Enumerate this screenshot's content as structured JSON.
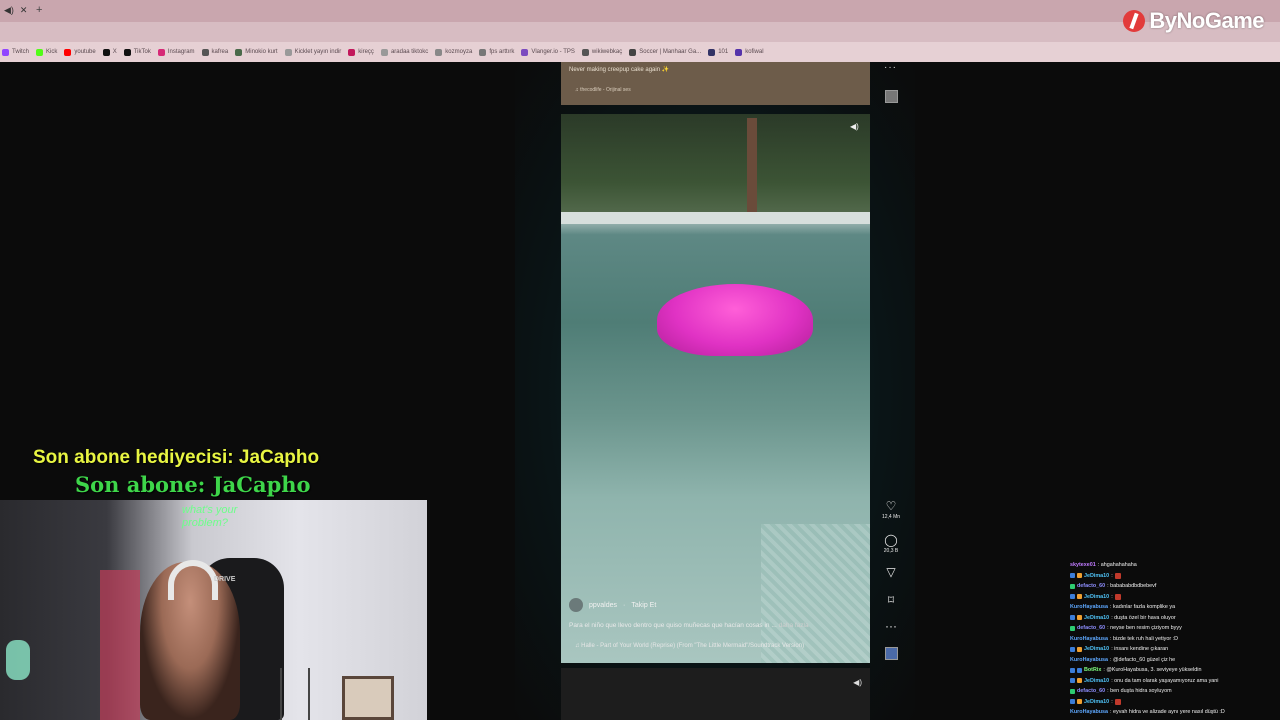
{
  "browser": {
    "bookmarks": [
      {
        "label": "Twitch",
        "color": "#9146ff"
      },
      {
        "label": "Kick",
        "color": "#53fc18"
      },
      {
        "label": "youtube",
        "color": "#ff0000"
      },
      {
        "label": "X",
        "color": "#111111"
      },
      {
        "label": "TikTok",
        "color": "#111111"
      },
      {
        "label": "Instagram",
        "color": "#d62976"
      },
      {
        "label": "kafrea",
        "color": "#555555"
      },
      {
        "label": "Minokio kurt",
        "color": "#4a6a4a"
      },
      {
        "label": "Kicklet yayın indir",
        "color": "#999999"
      },
      {
        "label": "kireçç",
        "color": "#c2185b"
      },
      {
        "label": "aradaa tiktokc",
        "color": "#999999"
      },
      {
        "label": "kozmoyza",
        "color": "#888888"
      },
      {
        "label": "fps arttırk",
        "color": "#777777"
      },
      {
        "label": "Vlanger.io - TPS",
        "color": "#7b4bbf"
      },
      {
        "label": "wikiwebkaç",
        "color": "#555555"
      },
      {
        "label": "Soccer | Manhaar Ga...",
        "color": "#444444"
      },
      {
        "label": "101",
        "color": "#333366"
      },
      {
        "label": "kofiwal",
        "color": "#5533aa"
      }
    ],
    "logo_text": "ByNoGame"
  },
  "feed": {
    "prev_card": {
      "caption": "Never making creepup cake again ✨",
      "sound": "♫  thecodlife - Orijinal ses"
    },
    "video": {
      "author": "ppvaldes",
      "separator": "·",
      "follow_label": "Takip Et",
      "caption": "Para el niño que llevo dentro que quiso muñecas que hacían cosas in ...",
      "more_label": "daha fazla",
      "song": "♫  Halle - Part of Your World (Reprise) (From \"The Little Mermaid\"/Soundtrack Version)"
    },
    "actions": {
      "likes": "12,4 Mn",
      "comments": "20,3 B"
    }
  },
  "overlay": {
    "last_gifter": "Son abone hediyecisi: JaCapho",
    "last_sub": "Son abone: JaCapho"
  },
  "webcam": {
    "neon_sign": "what's your problem?",
    "chair_brand": "DRIVE"
  },
  "chat": [
    {
      "user": "skytexe01",
      "color": "#c07bff",
      "text": ": ahgahahahaha",
      "badges": [],
      "emote": false
    },
    {
      "user": "JeDima10",
      "color": "#4fc3f7",
      "text": ":",
      "badges": [
        "#3b7dd8",
        "#f0a030"
      ],
      "emote": true
    },
    {
      "user": "defacto_60",
      "color": "#8f8fff",
      "text": ": babababdbdbebevf",
      "badges": [
        "#2ecc71"
      ],
      "emote": false
    },
    {
      "user": "JeDima10",
      "color": "#4fc3f7",
      "text": ":",
      "badges": [
        "#3b7dd8",
        "#f0a030"
      ],
      "emote": true
    },
    {
      "user": "KuroHayabusa",
      "color": "#5ea8ff",
      "text": ": kadınlar fazla komplike ya",
      "badges": [],
      "emote": false
    },
    {
      "user": "JeDima10",
      "color": "#4fc3f7",
      "text": ": duşta özel bir hava oluyor",
      "badges": [
        "#3b7dd8",
        "#f0a030"
      ],
      "emote": false
    },
    {
      "user": "defacto_60",
      "color": "#8f8fff",
      "text": ": neyse ben resim çiziyom byyy",
      "badges": [
        "#2ecc71"
      ],
      "emote": false
    },
    {
      "user": "KuroHayabusa",
      "color": "#5ea8ff",
      "text": ": bizde tek ruh hali yetiyor :D",
      "badges": [],
      "emote": false
    },
    {
      "user": "JeDima10",
      "color": "#4fc3f7",
      "text": ": insanı kendine çıkaran",
      "badges": [
        "#3b7dd8",
        "#f0a030"
      ],
      "emote": false
    },
    {
      "user": "KuroHayabusa",
      "color": "#5ea8ff",
      "text": ": @defacto_60 güzel çiz he",
      "badges": [],
      "emote": false
    },
    {
      "user": "BotRix",
      "color": "#7fff7f",
      "text": ": @KuroHayabusa, 3. seviyeye yükseldin",
      "badges": [
        "#3b7dd8",
        "#3b7dd8"
      ],
      "emote": false
    },
    {
      "user": "JeDima10",
      "color": "#4fc3f7",
      "text": ": onu da tam olarak yaşayamıyoruz ama yani",
      "badges": [
        "#3b7dd8",
        "#f0a030"
      ],
      "emote": false
    },
    {
      "user": "defacto_60",
      "color": "#8f8fff",
      "text": ": ben duşta hidra soyluyom",
      "badges": [
        "#2ecc71"
      ],
      "emote": false
    },
    {
      "user": "JeDima10",
      "color": "#4fc3f7",
      "text": ":",
      "badges": [
        "#3b7dd8",
        "#f0a030"
      ],
      "emote": true
    },
    {
      "user": "KuroHayabusa",
      "color": "#5ea8ff",
      "text": ": eyvah hidra ve alizade aynı yere nasıl düştü :D",
      "badges": [],
      "emote": false
    }
  ]
}
